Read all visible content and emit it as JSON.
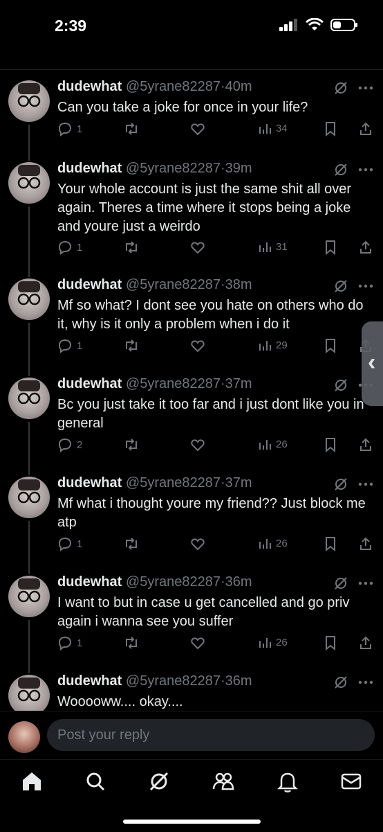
{
  "status_bar": {
    "time": "2:39"
  },
  "tweets": [
    {
      "name": "dudewhat",
      "handle": "@5yrane82287",
      "time": "40m",
      "text": "Can you take a joke for once in your life?",
      "replies": "1",
      "views": "34"
    },
    {
      "name": "dudewhat",
      "handle": "@5yrane82287",
      "time": "39m",
      "text": "Your whole account is just the same shit all over again. Theres a time where it stops being a joke and youre just a weirdo",
      "replies": "1",
      "views": "31"
    },
    {
      "name": "dudewhat",
      "handle": "@5yrane82287",
      "time": "38m",
      "text": "Mf so what? I dont see you hate on others who do it, why is it only a problem when i do it",
      "replies": "1",
      "views": "29"
    },
    {
      "name": "dudewhat",
      "handle": "@5yrane82287",
      "time": "37m",
      "text": "Bc you just take it too far and i just dont like you in general",
      "replies": "2",
      "views": "26"
    },
    {
      "name": "dudewhat",
      "handle": "@5yrane82287",
      "time": "37m",
      "text": "Mf what i thought youre my friend?? Just block me atp",
      "replies": "1",
      "views": "26"
    },
    {
      "name": "dudewhat",
      "handle": "@5yrane82287",
      "time": "36m",
      "text": "I want to but in case u get cancelled and go priv again i wanna see you suffer",
      "replies": "1",
      "views": "26"
    },
    {
      "name": "dudewhat",
      "handle": "@5yrane82287",
      "time": "36m",
      "text": "Wooooww.... okay....",
      "replies": "",
      "views": ""
    }
  ],
  "reply_bar": {
    "placeholder": "Post your reply"
  },
  "nav": [
    "home-icon",
    "search-icon",
    "grok-icon",
    "communities-icon",
    "notifications-icon",
    "messages-icon"
  ],
  "colors": {
    "background": "#000000",
    "text": "#e7e9ea",
    "muted": "#71767b",
    "input_bg": "#202327"
  }
}
